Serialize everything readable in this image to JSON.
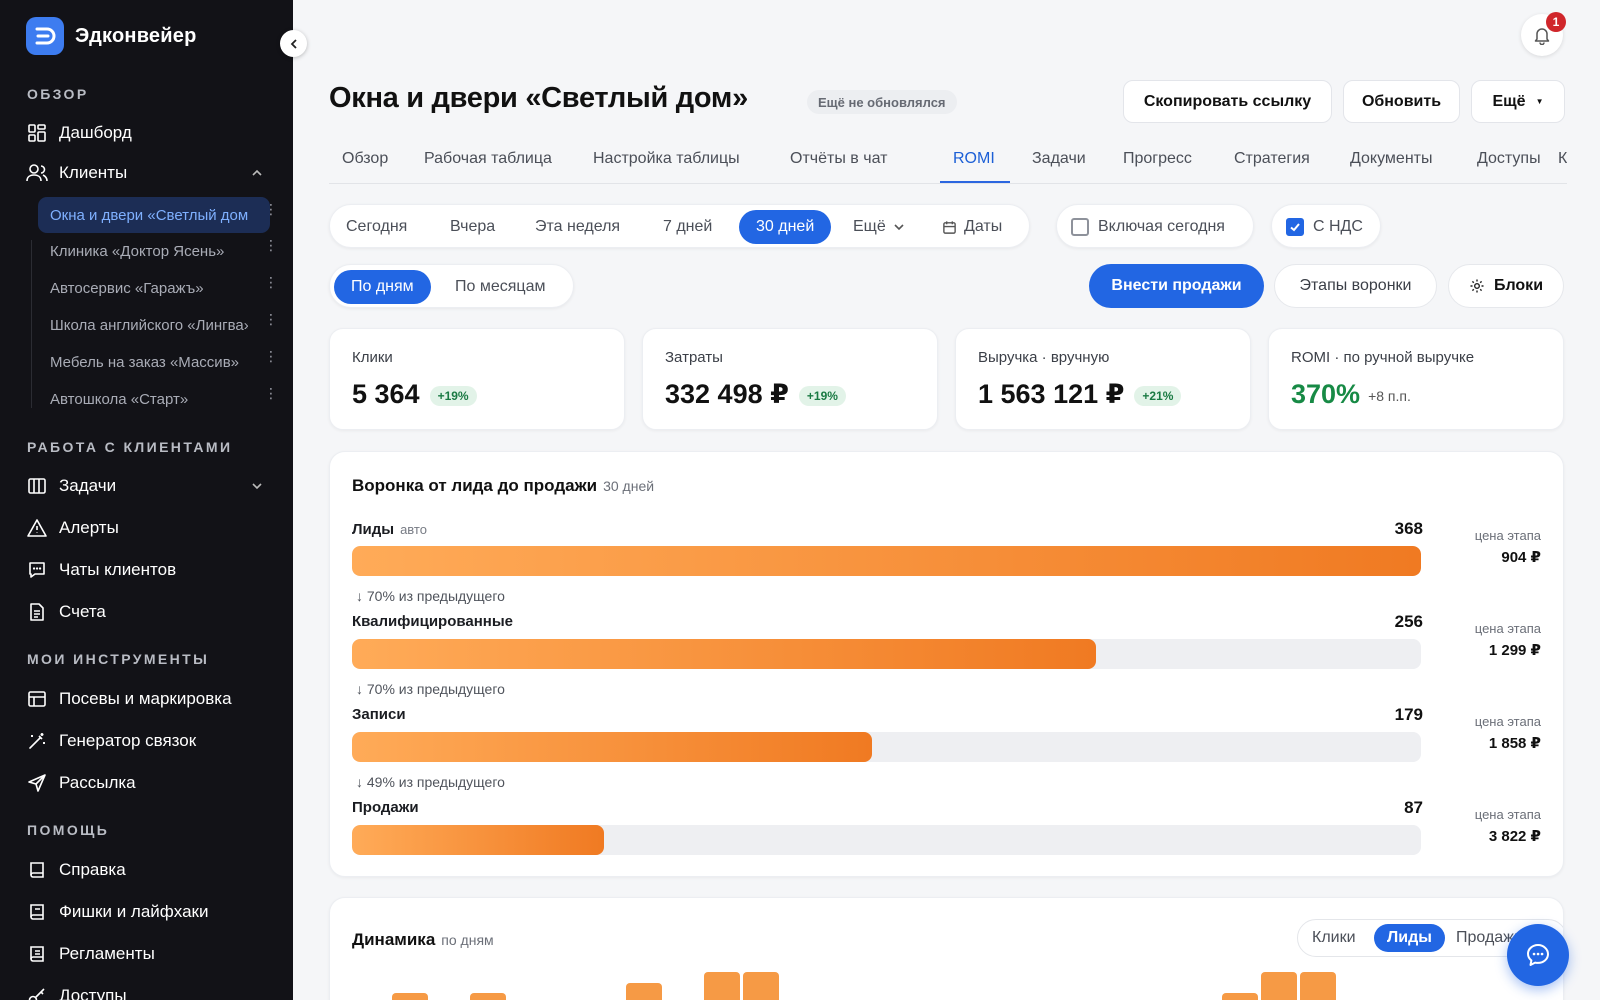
{
  "sidebar": {
    "brand": "Эдконвейер",
    "sections": {
      "overview": "ОБЗОР",
      "work": "РАБОТА С КЛИЕНТАМИ",
      "tools": "МОИ ИНСТРУМЕНТЫ",
      "help": "ПОМОЩЬ"
    },
    "items": {
      "dashboard": "Дашборд",
      "clients": "Клиенты",
      "tasks": "Задачи",
      "alerts": "Алерты",
      "chats": "Чаты клиентов",
      "invoices": "Счета",
      "seeding": "Посевы и маркировка",
      "generator": "Генератор связок",
      "mailing": "Рассылка",
      "reference": "Справка",
      "tips": "Фишки и лайфхаки",
      "rules": "Регламенты",
      "access": "Доступы"
    },
    "clients": [
      "Окна и двери «Светлый дом»",
      "Клиника «Доктор Ясень»",
      "Автосервис «Гаражъ»",
      "Школа английского «Лингва»",
      "Мебель на заказ «Массив»",
      "Автошкола «Старт»"
    ]
  },
  "header": {
    "notifications": "1",
    "title": "Окна и двери «Светлый дом»",
    "status": "Ещё не обновлялся",
    "copy_link": "Скопировать ссылку",
    "refresh": "Обновить",
    "more": "Ещё"
  },
  "tabs": [
    "Обзор",
    "Рабочая таблица",
    "Настройка таблицы",
    "Отчёты в чат",
    "ROMI",
    "Задачи",
    "Прогресс",
    "Стратегия",
    "Документы",
    "Доступы",
    "К"
  ],
  "filters": {
    "periods": [
      "Сегодня",
      "Вчера",
      "Эта неделя",
      "7 дней",
      "30 дней"
    ],
    "more": "Ещё",
    "dates": "Даты",
    "include_today": "Включая сегодня",
    "with_vat": "С НДС",
    "by_days": "По дням",
    "by_months": "По месяцам",
    "enter_sales": "Внести продажи",
    "funnel_stages": "Этапы воронки",
    "blocks": "Блоки"
  },
  "kpis": [
    {
      "label": "Клики",
      "value": "5 364",
      "delta": "+19%"
    },
    {
      "label": "Затраты",
      "value": "332 498 ₽",
      "delta": "+19%"
    },
    {
      "label": "Выручка · вручную",
      "value": "1 563 121 ₽",
      "delta": "+21%"
    },
    {
      "label": "ROMI · по ручной выручке",
      "value": "370%",
      "delta": "+8 п.п."
    }
  ],
  "funnel": {
    "title": "Воронка от лида до продажи",
    "period": "30 дней",
    "price_label": "цена этапа",
    "stages": [
      {
        "name": "Лиды",
        "tag": "авто",
        "count": 368,
        "fill": 1.0,
        "price": "904 ₽"
      },
      {
        "name": "Квалифицированные",
        "count": 256,
        "fill": 0.696,
        "price": "1 299 ₽",
        "conv": "↓ 70% из предыдущего"
      },
      {
        "name": "Записи",
        "count": 179,
        "fill": 0.486,
        "price": "1 858 ₽",
        "conv": "↓ 70% из предыдущего"
      },
      {
        "name": "Продажи",
        "count": 87,
        "fill": 0.236,
        "price": "3 822 ₽",
        "conv": "↓ 49% из предыдущего"
      }
    ]
  },
  "dynamics": {
    "title": "Динамика",
    "subtitle": "по дням",
    "segments": [
      "Клики",
      "Лиды",
      "Продажи"
    ]
  },
  "colors": {
    "accent": "#2266e3",
    "sidebar_bg": "#121217",
    "bar_start": "#ffab58",
    "bar_end": "#f07a22",
    "positive": "#178a45"
  }
}
